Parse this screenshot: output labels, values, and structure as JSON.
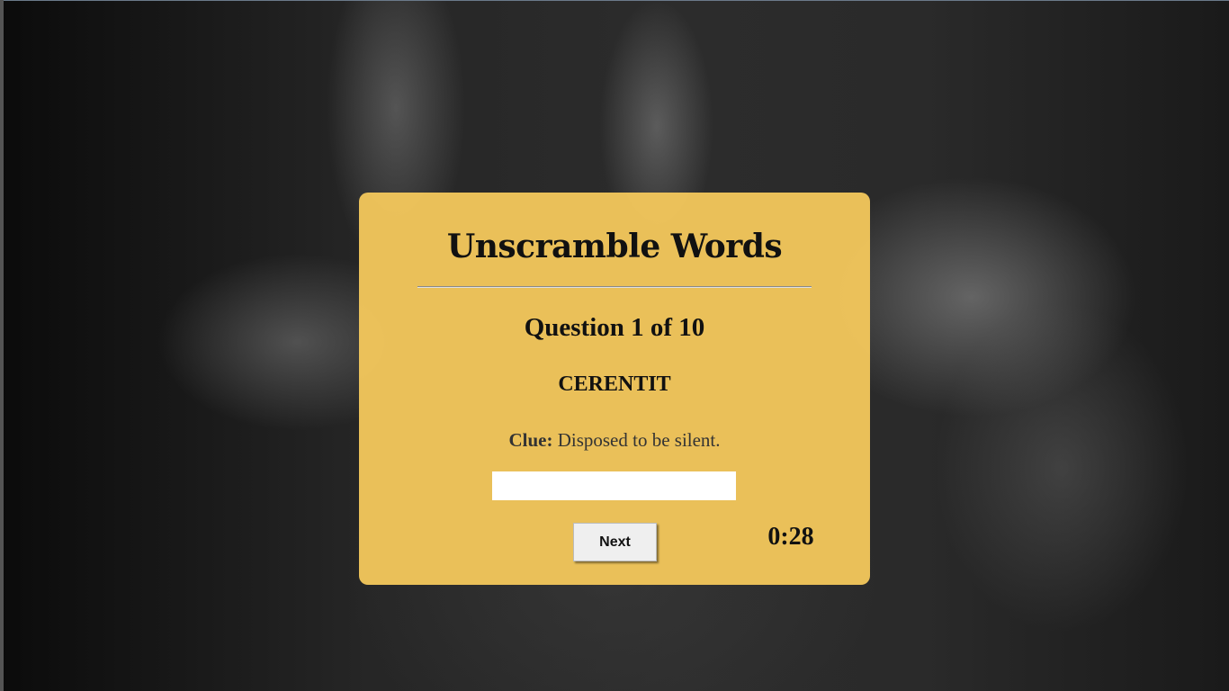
{
  "game": {
    "title": "Unscramble Words",
    "question_label": "Question 1 of 10",
    "current_question": 1,
    "total_questions": 10,
    "scrambled_word": "CERENTIT",
    "clue_label": "Clue:",
    "clue_text": "Disposed to be silent.",
    "answer_value": "",
    "next_label": "Next",
    "timer": "0:28"
  },
  "colors": {
    "card_background": "#F4C85C",
    "text": "#111111",
    "button_background": "#EFEFEF"
  }
}
